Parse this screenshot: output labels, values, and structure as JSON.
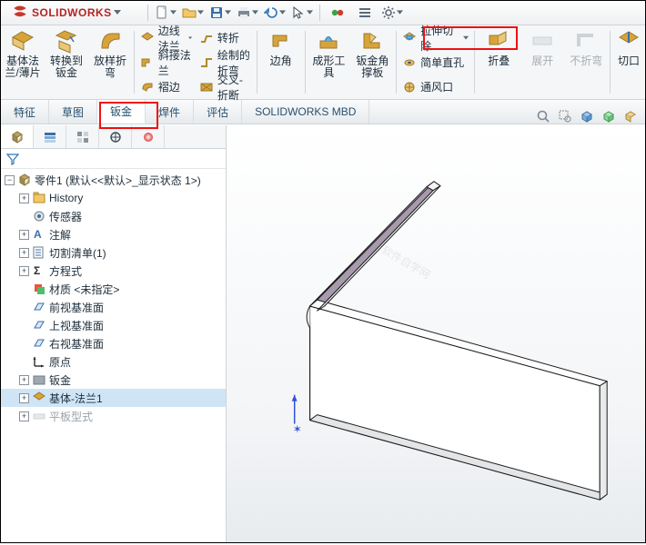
{
  "app": {
    "brand_solid": "SOLID",
    "brand_works": "WORKS"
  },
  "ribbon": {
    "big": {
      "base_flange": "基体法\n兰/薄片",
      "convert_sm": "转换到\n钣金",
      "lofted_bend": "放样折\n弯",
      "edge_flange": "边线法兰",
      "miter_flange": "斜接法兰",
      "hem": "褶边",
      "jog": "转折",
      "sketched_bend": "绘制的折弯",
      "cross_break": "交叉-折断",
      "corner": "边角",
      "forming_tool": "成形工\n具",
      "gusset": "钣金角\n撑板",
      "extruded_cut": "拉伸切除",
      "simple_hole": "简单直孔",
      "vent": "通风口",
      "fold": "折叠",
      "unfold": "展开",
      "no_bend": "不折弯",
      "cut": "切口"
    },
    "tabs": {
      "features": "特征",
      "sketch": "草图",
      "sheetmetal": "钣金",
      "weldments": "焊件",
      "evaluate": "评估",
      "mbd": "SOLIDWORKS MBD"
    }
  },
  "tree": {
    "root": "零件1  (默认<<默认>_显示状态 1>)",
    "history": "History",
    "sensors": "传感器",
    "annotations": "注解",
    "cutlist": "切割清单(1)",
    "equations": "方程式",
    "material": "材质 <未指定>",
    "front": "前视基准面",
    "top": "上视基准面",
    "right": "右视基准面",
    "origin": "原点",
    "sheetmetal": "钣金",
    "baseflange1": "基体-法兰1",
    "flatpattern": "平板型式"
  }
}
